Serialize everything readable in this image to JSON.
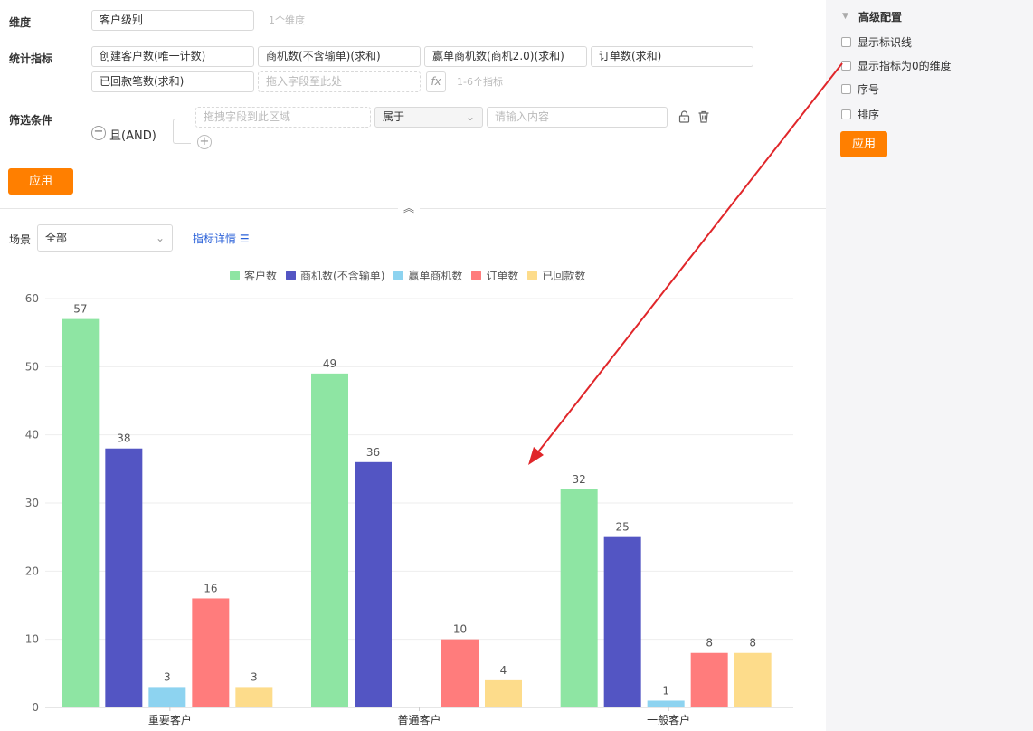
{
  "form": {
    "dimension_label": "维度",
    "dimension_value": "客户级别",
    "dimension_hint": "1个维度",
    "metrics_label": "统计指标",
    "metrics": [
      "创建客户数(唯一计数)",
      "商机数(不含输单)(求和)",
      "赢单商机数(商机2.0)(求和)",
      "订单数(求和)",
      "已回款笔数(求和)"
    ],
    "metrics_drop_placeholder": "拖入字段至此处",
    "fx_label": "fx",
    "metrics_hint": "1-6个指标",
    "filter_label": "筛选条件",
    "filter_logic": "且(AND)",
    "filter_field_placeholder": "拖拽字段到此区域",
    "filter_operator": "属于",
    "filter_value_placeholder": "请输入内容",
    "apply_label": "应用"
  },
  "toolbar": {
    "scene_label": "场景",
    "scene_value": "全部",
    "detail_link": "指标详情"
  },
  "sidebar": {
    "title": "高级配置",
    "options": [
      "显示标识线",
      "显示指标为0的维度",
      "序号",
      "排序"
    ],
    "apply_label": "应用"
  },
  "chart_data": {
    "type": "bar",
    "categories": [
      "重要客户",
      "普通客户",
      "一般客户"
    ],
    "series": [
      {
        "name": "客户数",
        "color": "#8ee5a3",
        "values": [
          57,
          49,
          32
        ]
      },
      {
        "name": "商机数(不含输单)",
        "color": "#5355c3",
        "values": [
          38,
          36,
          25
        ]
      },
      {
        "name": "赢单商机数",
        "color": "#8dd3f0",
        "values": [
          3,
          0,
          1
        ]
      },
      {
        "name": "订单数",
        "color": "#ff7c7c",
        "values": [
          16,
          10,
          8
        ]
      },
      {
        "name": "已回款数",
        "color": "#fddc8b",
        "values": [
          3,
          4,
          8
        ]
      }
    ],
    "ylim": [
      0,
      60
    ],
    "yticks": [
      0,
      10,
      20,
      30,
      40,
      50,
      60
    ],
    "legend": "top-center",
    "grid": true
  },
  "annotation": {
    "color": "#e0262a"
  }
}
